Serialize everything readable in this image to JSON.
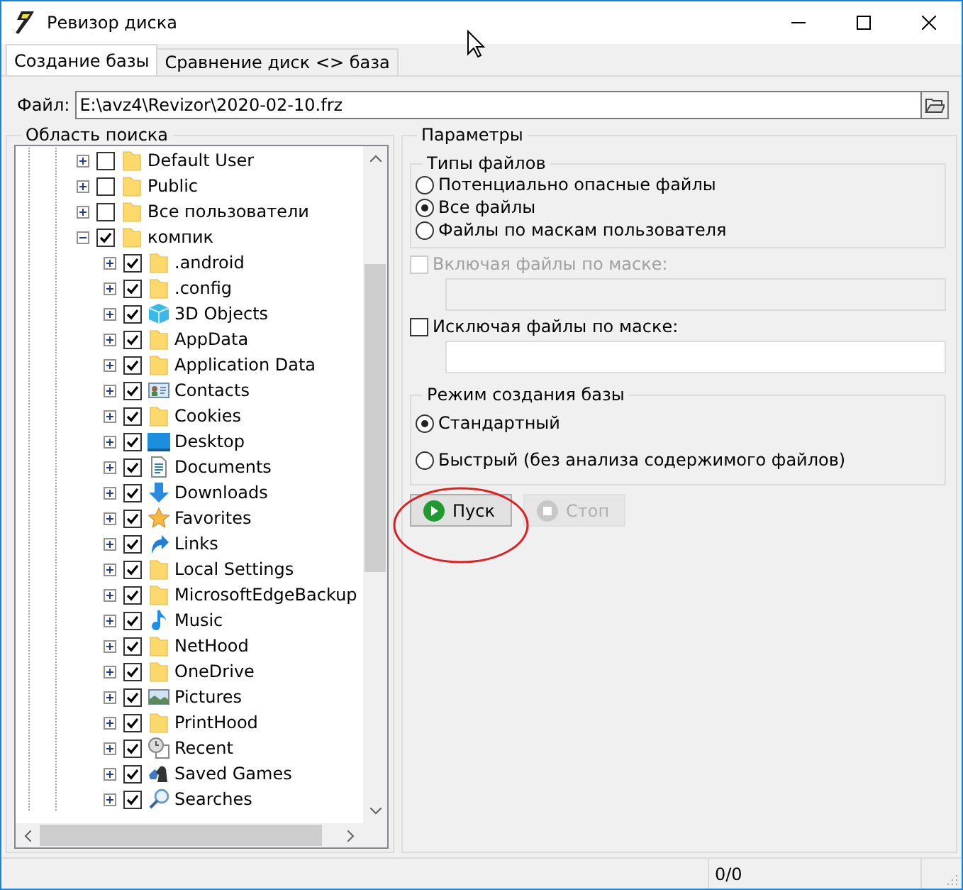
{
  "window": {
    "title": "Ревизор диска"
  },
  "tabs": [
    {
      "label": "Создание базы",
      "selected": true
    },
    {
      "label": "Сравнение диск <> база",
      "selected": false
    }
  ],
  "file": {
    "label": "Файл:",
    "value": "E:\\avz4\\Revizor\\2020-02-10.frz"
  },
  "search_area": {
    "title": "Область поиска",
    "tree": [
      {
        "label": "Default User",
        "kind": "folder",
        "checked": false,
        "expanded": false
      },
      {
        "label": "Public",
        "kind": "folder",
        "checked": false,
        "expanded": false
      },
      {
        "label": "Все пользователи",
        "kind": "folder",
        "checked": false,
        "expanded": false
      },
      {
        "label": "компик",
        "kind": "folder",
        "checked": true,
        "expanded": true,
        "children": [
          {
            "label": ".android",
            "kind": "folder",
            "checked": true,
            "expanded": false
          },
          {
            "label": ".config",
            "kind": "folder",
            "checked": true,
            "expanded": false
          },
          {
            "label": "3D Objects",
            "kind": "cube",
            "checked": true,
            "expanded": false
          },
          {
            "label": "AppData",
            "kind": "folder",
            "checked": true,
            "expanded": false
          },
          {
            "label": "Application Data",
            "kind": "folder",
            "checked": true,
            "expanded": false
          },
          {
            "label": "Contacts",
            "kind": "contacts",
            "checked": true,
            "expanded": false
          },
          {
            "label": "Cookies",
            "kind": "folder",
            "checked": true,
            "expanded": false
          },
          {
            "label": "Desktop",
            "kind": "desktop",
            "checked": true,
            "expanded": false
          },
          {
            "label": "Documents",
            "kind": "document",
            "checked": true,
            "expanded": false
          },
          {
            "label": "Downloads",
            "kind": "download",
            "checked": true,
            "expanded": false
          },
          {
            "label": "Favorites",
            "kind": "star",
            "checked": true,
            "expanded": false
          },
          {
            "label": "Links",
            "kind": "link",
            "checked": true,
            "expanded": false
          },
          {
            "label": "Local Settings",
            "kind": "folder",
            "checked": true,
            "expanded": false
          },
          {
            "label": "MicrosoftEdgeBackup",
            "kind": "folder",
            "checked": true,
            "expanded": false
          },
          {
            "label": "Music",
            "kind": "music",
            "checked": true,
            "expanded": false
          },
          {
            "label": "NetHood",
            "kind": "folder",
            "checked": true,
            "expanded": false
          },
          {
            "label": "OneDrive",
            "kind": "folder",
            "checked": true,
            "expanded": false
          },
          {
            "label": "Pictures",
            "kind": "pictures",
            "checked": true,
            "expanded": false
          },
          {
            "label": "PrintHood",
            "kind": "folder",
            "checked": true,
            "expanded": false
          },
          {
            "label": "Recent",
            "kind": "recent",
            "checked": true,
            "expanded": false
          },
          {
            "label": "Saved Games",
            "kind": "games",
            "checked": true,
            "expanded": false
          },
          {
            "label": "Searches",
            "kind": "search",
            "checked": true,
            "expanded": false
          }
        ]
      }
    ]
  },
  "parameters": {
    "title": "Параметры",
    "file_types": {
      "title": "Типы файлов",
      "options": [
        {
          "label": "Потенциально опасные файлы",
          "selected": false
        },
        {
          "label": "Все файлы",
          "selected": true
        },
        {
          "label": "Файлы по маскам пользователя",
          "selected": false
        }
      ]
    },
    "masks": [
      {
        "label": "Включая файлы по маске:",
        "checked": false,
        "disabled": true
      },
      {
        "label": "Исключая файлы по маске:",
        "checked": false,
        "disabled": false
      }
    ],
    "mode": {
      "title": "Режим создания базы",
      "options": [
        {
          "label": "Стандартный",
          "selected": true
        },
        {
          "label": "Быстрый (без анализа содержимого файлов)",
          "selected": false
        }
      ]
    },
    "buttons": [
      {
        "label": "Пуск",
        "kind": "start",
        "disabled": false
      },
      {
        "label": "Стоп",
        "kind": "stop",
        "disabled": true
      }
    ]
  },
  "status_bar": {
    "counter": "0/0"
  }
}
